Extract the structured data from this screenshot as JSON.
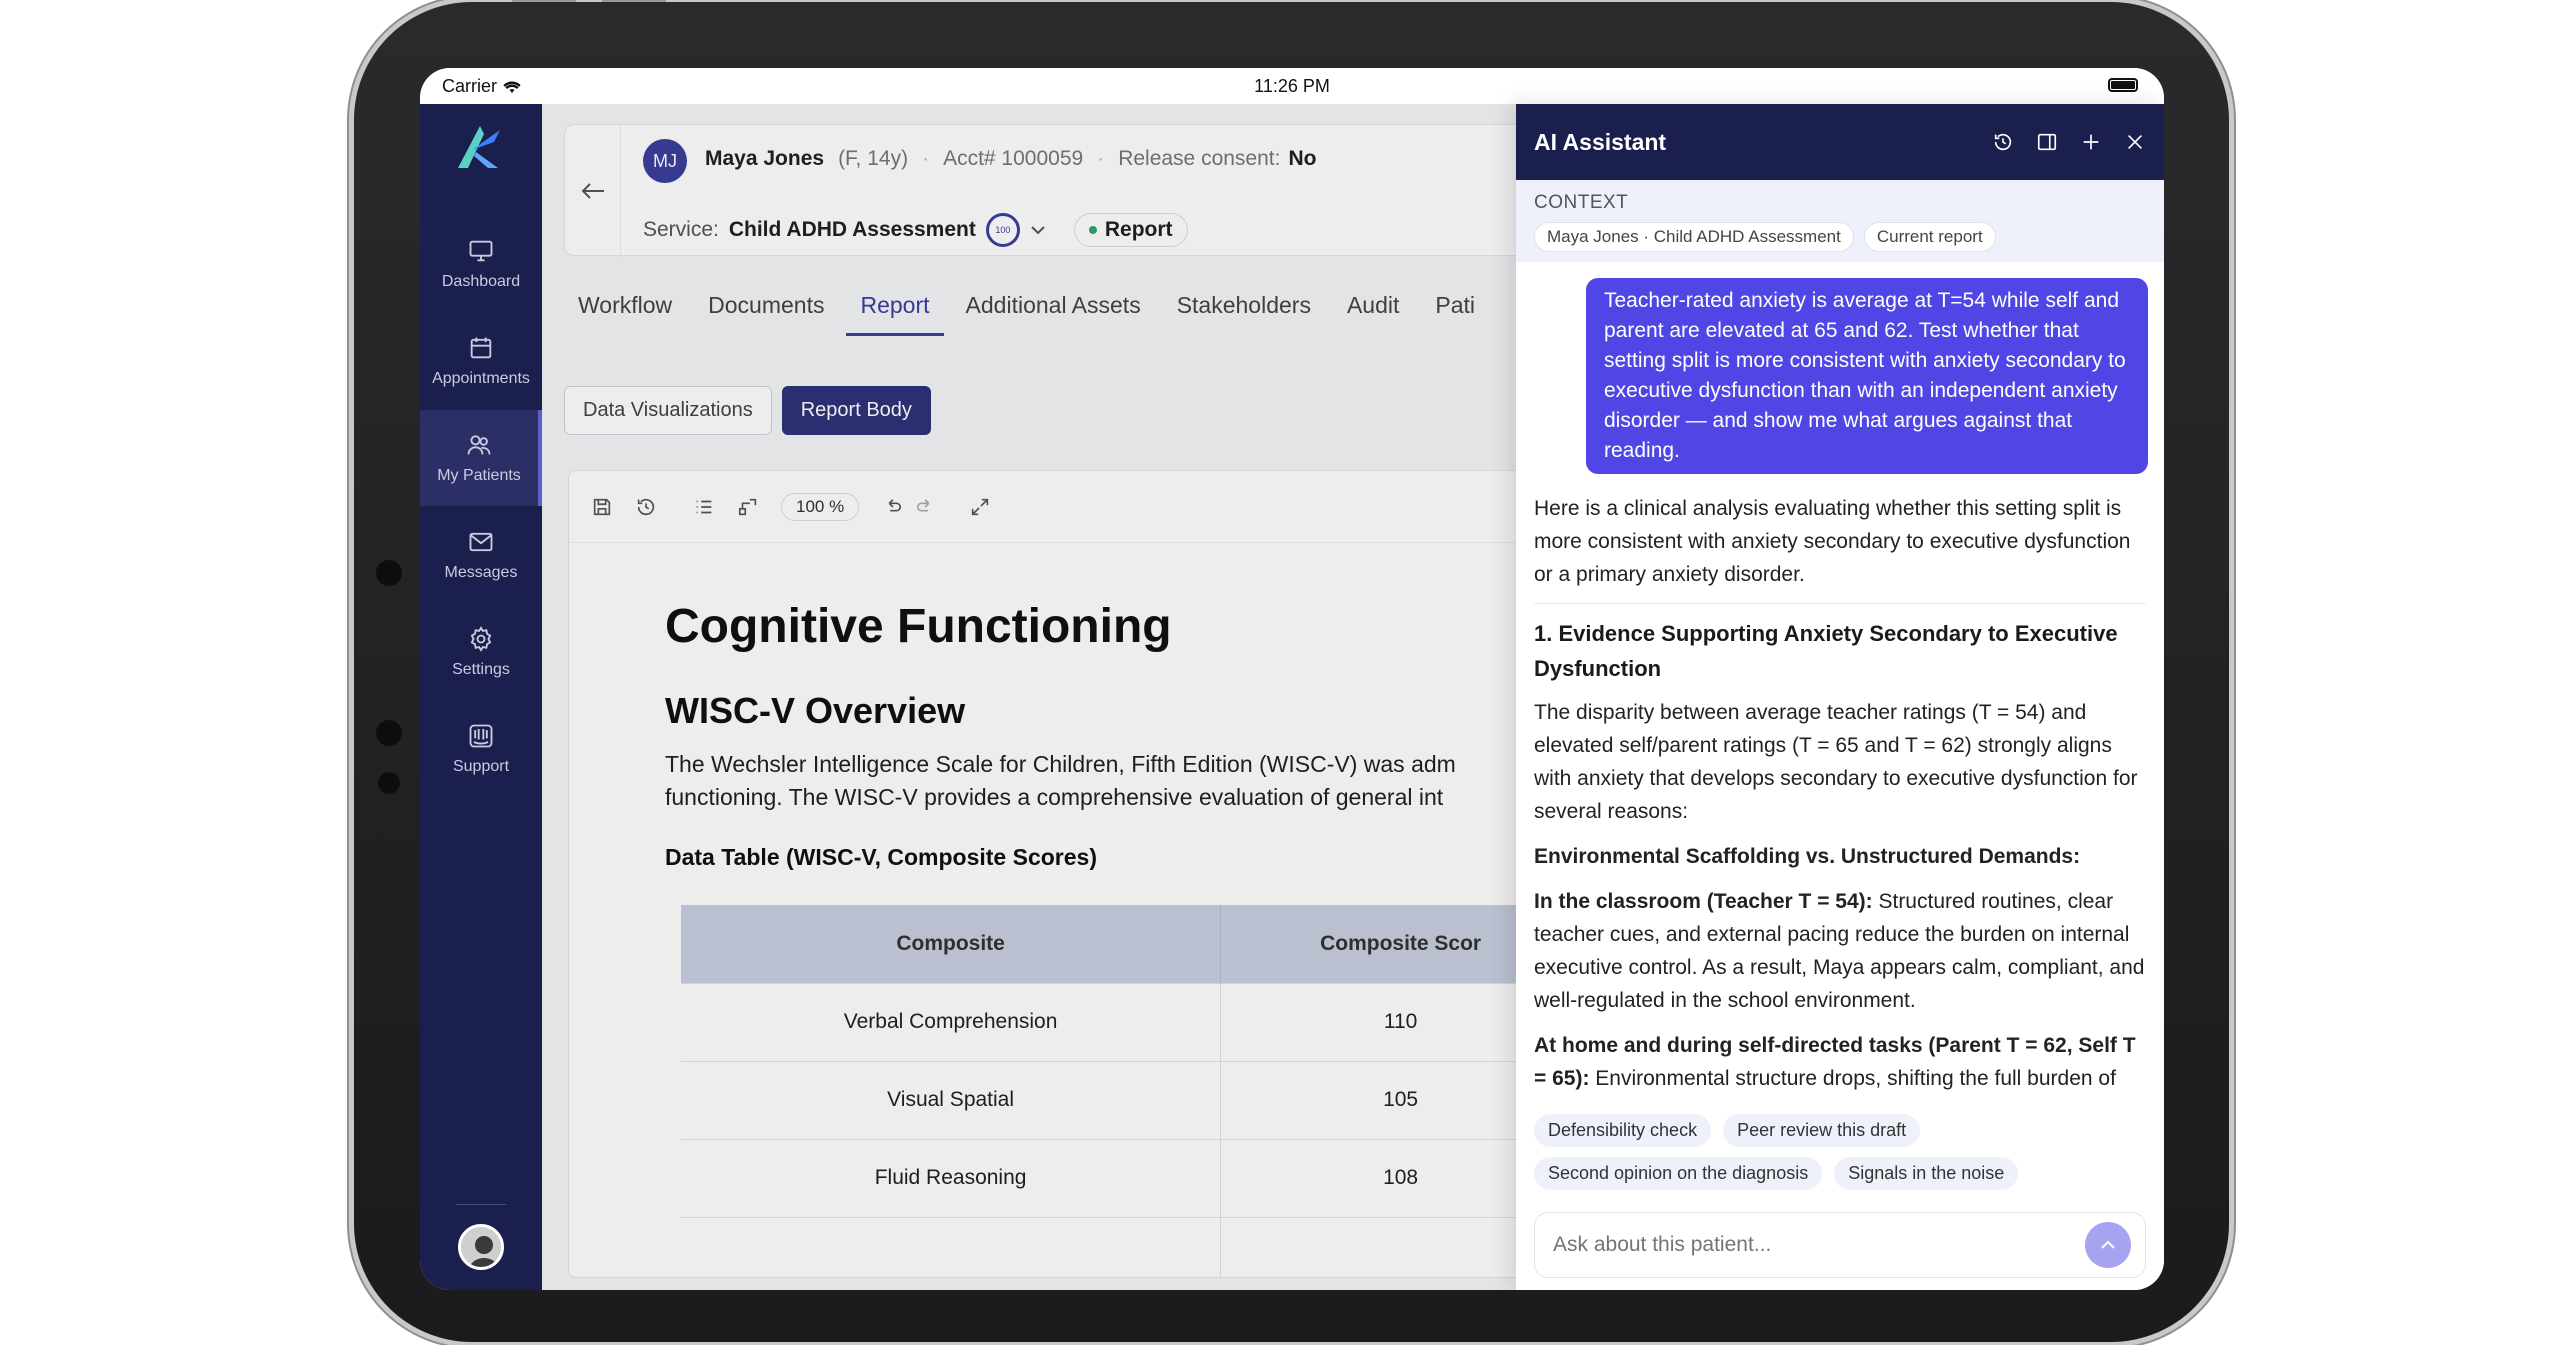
{
  "status_bar": {
    "carrier": "Carrier",
    "time": "11:26 PM"
  },
  "sidebar": {
    "items": [
      {
        "label": "Dashboard",
        "icon": "monitor-icon"
      },
      {
        "label": "Appointments",
        "icon": "calendar-icon"
      },
      {
        "label": "My Patients",
        "icon": "users-icon"
      },
      {
        "label": "Messages",
        "icon": "mail-icon"
      },
      {
        "label": "Settings",
        "icon": "gear-icon"
      },
      {
        "label": "Support",
        "icon": "support-icon"
      }
    ],
    "active": "My Patients"
  },
  "patient": {
    "initials": "MJ",
    "name": "Maya Jones",
    "meta": "(F, 14y)",
    "account": "Acct# 1000059",
    "consent_label": "Release consent:",
    "consent_value": "No",
    "service_label": "Service:",
    "service_value": "Child ADHD Assessment",
    "score": "100",
    "report_chip": "Report"
  },
  "tabs": [
    "Workflow",
    "Documents",
    "Report",
    "Additional Assets",
    "Stakeholders",
    "Audit",
    "Pati"
  ],
  "active_tab": "Report",
  "segments": [
    "Data Visualizations",
    "Report Body"
  ],
  "editor": {
    "zoom": "100 %",
    "heading": "Cognitive Functioning",
    "subheading": "WISC-V Overview",
    "para_line1": "The Wechsler Intelligence Scale for Children, Fifth Edition (WISC-V) was adm",
    "para_line2": "functioning. The WISC-V provides a comprehensive evaluation of general int",
    "table_title": "Data Table (WISC-V, Composite Scores)",
    "table": {
      "headers": [
        "Composite",
        "Composite Scor"
      ],
      "rows": [
        [
          "Verbal Comprehension",
          "110"
        ],
        [
          "Visual Spatial",
          "105"
        ],
        [
          "Fluid Reasoning",
          "108"
        ]
      ]
    }
  },
  "ai": {
    "title": "AI Assistant",
    "context_label": "CONTEXT",
    "context_chips": [
      "Maya Jones · Child ADHD Assessment",
      "Current report"
    ],
    "user_message": "Teacher-rated anxiety is average at T=54 while self and parent are elevated at 65 and 62. Test whether that setting split is more consistent with anxiety secondary to executive dysfunction than with an independent anxiety disorder — and show me what argues against that reading.",
    "intro": "Here is a clinical analysis evaluating whether this setting split is more consistent with anxiety secondary to executive dysfunction or a primary anxiety disorder.",
    "section_heading": "1. Evidence Supporting Anxiety Secondary to Executive Dysfunction",
    "section_para": "The disparity between average teacher ratings (T = 54) and elevated self/parent ratings (T = 65 and T = 62) strongly aligns with anxiety that develops secondary to executive dysfunction for several reasons:",
    "sub_heading": "Environmental Scaffolding vs. Unstructured Demands:",
    "bullet1_bold": "In the classroom (Teacher T = 54):",
    "bullet1_text": " Structured routines, clear teacher cues, and external pacing reduce the burden on internal executive control. As a result, Maya appears calm, compliant, and well-regulated in the school environment.",
    "bullet2_bold": "At home and during self-directed tasks (Parent T = 62, Self T = 65):",
    "bullet2_text": " Environmental structure drops, shifting the full burden of",
    "suggestions": [
      "Defensibility check",
      "Peer review this draft",
      "Second opinion on the diagnosis",
      "Signals in the noise"
    ],
    "input_placeholder": "Ask about this patient..."
  }
}
